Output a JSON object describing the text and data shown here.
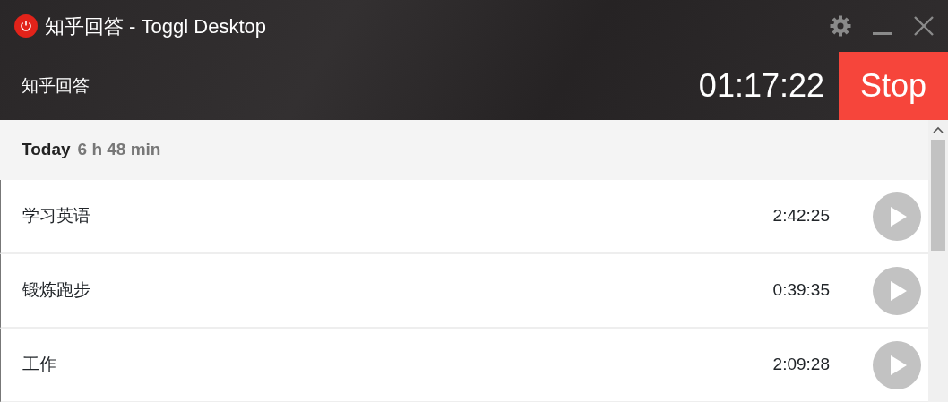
{
  "window": {
    "title": "知乎回答 - Toggl Desktop"
  },
  "timer": {
    "description": "知乎回答",
    "duration": "01:17:22",
    "button": "Stop"
  },
  "day": {
    "label": "Today",
    "total": "6 h 48 min"
  },
  "entries": [
    {
      "description": "学习英语",
      "duration": "2:42:25"
    },
    {
      "description": "锻炼跑步",
      "duration": "0:39:35"
    },
    {
      "description": "工作",
      "duration": "2:09:28"
    }
  ]
}
